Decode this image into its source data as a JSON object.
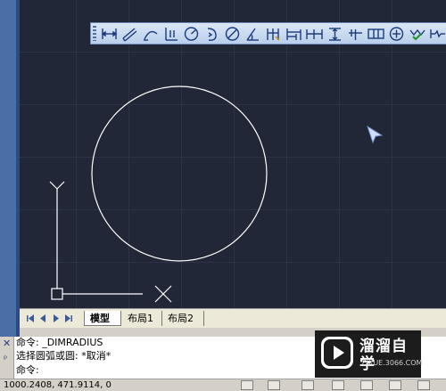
{
  "canvas": {
    "background": "#212736",
    "ucs": {
      "y_label": "Y",
      "x_label": "X"
    }
  },
  "dimension_toolbar": {
    "tools": [
      {
        "icon": "linear-dimension-icon"
      },
      {
        "icon": "aligned-dimension-icon"
      },
      {
        "icon": "arc-length-icon"
      },
      {
        "icon": "ordinate-dimension-icon"
      },
      {
        "icon": "radius-dimension-icon"
      },
      {
        "icon": "jogged-dimension-icon"
      },
      {
        "icon": "diameter-dimension-icon"
      },
      {
        "icon": "angular-dimension-icon"
      },
      {
        "icon": "quick-dimension-icon"
      },
      {
        "icon": "baseline-dimension-icon"
      },
      {
        "icon": "continue-dimension-icon"
      },
      {
        "icon": "dimension-space-icon"
      },
      {
        "icon": "dimension-break-icon"
      },
      {
        "icon": "tolerance-icon"
      },
      {
        "icon": "center-mark-icon"
      },
      {
        "icon": "inspection-icon"
      },
      {
        "icon": "jogged-linear-icon"
      }
    ]
  },
  "layout_tabs": {
    "tabs": [
      {
        "label": "模型",
        "active": true
      },
      {
        "label": "布局1",
        "active": false
      },
      {
        "label": "布局2",
        "active": false
      }
    ]
  },
  "command_window": {
    "close_glyph": "✕",
    "pin_glyph": "ᵖ",
    "lines": [
      "命令: _DIMRADIUS",
      "选择圆弧或圆: *取消*",
      "命令:"
    ]
  },
  "watermark": {
    "title": "溜溜自学",
    "url": "ZIXUE.3066.COM"
  },
  "status_bar": {
    "coordinates": "1000.2408, 471.9114, 0"
  }
}
